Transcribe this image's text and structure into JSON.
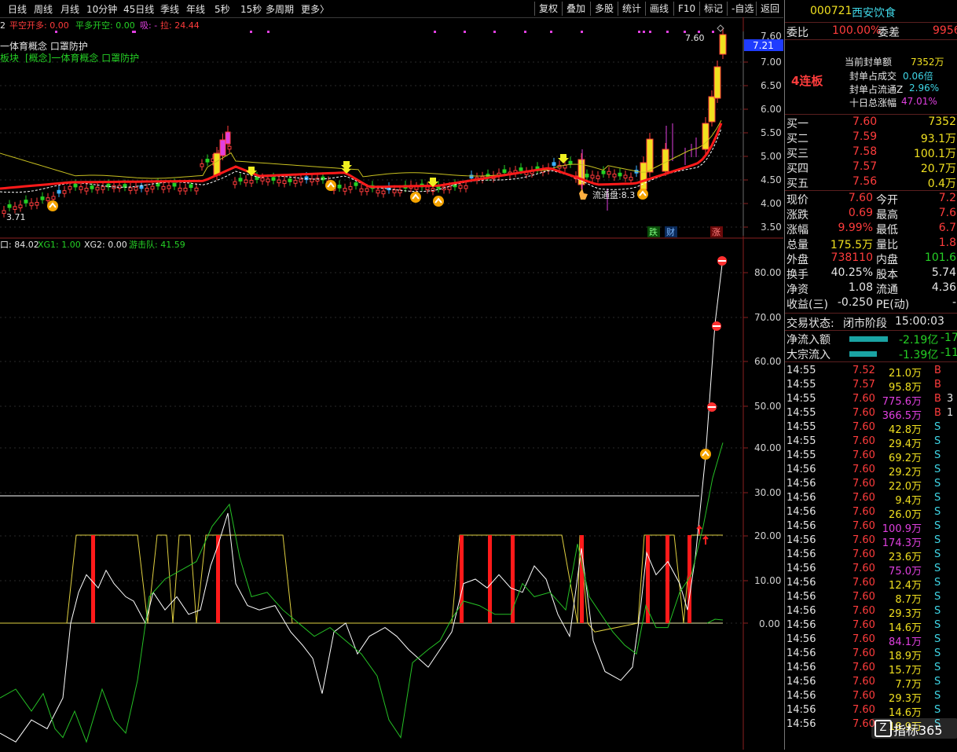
{
  "toolbar": {
    "periods": [
      "日线",
      "周线",
      "月线",
      "10分钟",
      "45日线",
      "季线",
      "年线",
      "5秒",
      "15秒",
      "多周期",
      "更多〉"
    ],
    "actions": [
      "复权",
      "叠加",
      "多股",
      "统计",
      "画线",
      "F10",
      "标记",
      "-自选",
      "返回"
    ]
  },
  "upper": {
    "legend1": {
      "a": "2",
      "b": "平空开多: 0.00",
      "c": "平多开空: 0.00",
      "d": "吸: -",
      "e": "拉: 24.44"
    },
    "concept_line1": "一体育概念 口罩防护",
    "concept_line2_a": "板块",
    "concept_line2_b": "[概念]一体育概念 口罩防护",
    "y_ticks": [
      "7.00",
      "6.50",
      "6.00",
      "5.50",
      "5.00",
      "4.50",
      "4.00",
      "3.50"
    ],
    "y_top": "7.60",
    "price_tag": "7.21",
    "high_label": "7.60",
    "low_label": "3.71",
    "float_label": "流通盘:8.3",
    "tags": {
      "die": "跌",
      "cai": "财",
      "zhang": "涨"
    }
  },
  "lower": {
    "legend": {
      "a": "口: 84.02",
      "b": "XG1: 1.00",
      "c": "XG2: 0.00",
      "d": "游击队: 41.59"
    },
    "y_ticks": [
      "80.00",
      "70.00",
      "60.00",
      "50.00",
      "40.00",
      "30.00",
      "20.00",
      "10.00",
      "0.00"
    ]
  },
  "stock": {
    "code": "000721",
    "name": "西安饮食"
  },
  "weibi": {
    "label": "委比",
    "value": "100.00%",
    "label2": "委差",
    "value2": "9956"
  },
  "seal": {
    "badge": "4连板",
    "rows": [
      {
        "label": "当前封单额",
        "value": "7352万"
      },
      {
        "label": "封单占成交",
        "value": "0.06倍"
      },
      {
        "label": "封单占流通Z",
        "value": "2.96%"
      },
      {
        "label": "十日总涨幅",
        "value": "47.01%"
      }
    ]
  },
  "buys": [
    {
      "label": "买一",
      "price": "7.60",
      "vol": "7352"
    },
    {
      "label": "买二",
      "price": "7.59",
      "vol": "93.1万"
    },
    {
      "label": "买三",
      "price": "7.58",
      "vol": "100.1万"
    },
    {
      "label": "买四",
      "price": "7.57",
      "vol": "20.7万"
    },
    {
      "label": "买五",
      "price": "7.56",
      "vol": "0.4万"
    }
  ],
  "quote": [
    {
      "l1": "现价",
      "v1": "7.60",
      "l2": "今开",
      "v2": "7.2"
    },
    {
      "l1": "涨跌",
      "v1": "0.69",
      "l2": "最高",
      "v2": "7.6"
    },
    {
      "l1": "涨幅",
      "v1": "9.99%",
      "l2": "最低",
      "v2": "6.7"
    },
    {
      "l1": "总量",
      "v1": "175.5万",
      "l2": "量比",
      "v2": "1.8"
    },
    {
      "l1": "外盘",
      "v1": "738110",
      "l2": "内盘",
      "v2": "101.6"
    },
    {
      "l1": "换手",
      "v1": "40.25%",
      "l2": "股本",
      "v2": "5.74"
    },
    {
      "l1": "净资",
      "v1": "1.08",
      "l2": "流通",
      "v2": "4.36"
    },
    {
      "l1": "收益(三)",
      "v1": "-0.250",
      "l2": "PE(动)",
      "v2": "-"
    }
  ],
  "status": {
    "label": "交易状态:",
    "value": "闭市阶段",
    "time": "15:00:03"
  },
  "flows": [
    {
      "label": "净流入额",
      "value": "-2.19亿",
      "extra": "-17",
      "bar": 0.85
    },
    {
      "label": "大宗流入",
      "value": "-1.39亿",
      "extra": "-11",
      "bar": 0.6
    }
  ],
  "ticks": [
    {
      "t": "14:55",
      "p": "7.52",
      "v": "21.0万",
      "s": "B",
      "n": ""
    },
    {
      "t": "14:55",
      "p": "7.57",
      "v": "95.8万",
      "s": "B",
      "n": ""
    },
    {
      "t": "14:55",
      "p": "7.60",
      "v": "775.6万",
      "s": "B",
      "n": "3"
    },
    {
      "t": "14:55",
      "p": "7.60",
      "v": "366.5万",
      "s": "B",
      "n": "1"
    },
    {
      "t": "14:55",
      "p": "7.60",
      "v": "42.8万",
      "s": "S",
      "n": ""
    },
    {
      "t": "14:55",
      "p": "7.60",
      "v": "29.4万",
      "s": "S",
      "n": ""
    },
    {
      "t": "14:55",
      "p": "7.60",
      "v": "69.2万",
      "s": "S",
      "n": ""
    },
    {
      "t": "14:56",
      "p": "7.60",
      "v": "29.2万",
      "s": "S",
      "n": ""
    },
    {
      "t": "14:56",
      "p": "7.60",
      "v": "22.0万",
      "s": "S",
      "n": ""
    },
    {
      "t": "14:56",
      "p": "7.60",
      "v": "9.4万",
      "s": "S",
      "n": ""
    },
    {
      "t": "14:56",
      "p": "7.60",
      "v": "26.0万",
      "s": "S",
      "n": ""
    },
    {
      "t": "14:56",
      "p": "7.60",
      "v": "100.9万",
      "s": "S",
      "n": ""
    },
    {
      "t": "14:56",
      "p": "7.60",
      "v": "174.3万",
      "s": "S",
      "n": ""
    },
    {
      "t": "14:56",
      "p": "7.60",
      "v": "23.6万",
      "s": "S",
      "n": ""
    },
    {
      "t": "14:56",
      "p": "7.60",
      "v": "75.0万",
      "s": "S",
      "n": ""
    },
    {
      "t": "14:56",
      "p": "7.60",
      "v": "12.4万",
      "s": "S",
      "n": ""
    },
    {
      "t": "14:56",
      "p": "7.60",
      "v": "8.7万",
      "s": "S",
      "n": ""
    },
    {
      "t": "14:56",
      "p": "7.60",
      "v": "29.3万",
      "s": "S",
      "n": ""
    },
    {
      "t": "14:56",
      "p": "7.60",
      "v": "14.6万",
      "s": "S",
      "n": ""
    },
    {
      "t": "14:56",
      "p": "7.60",
      "v": "84.1万",
      "s": "S",
      "n": ""
    },
    {
      "t": "14:56",
      "p": "7.60",
      "v": "18.9万",
      "s": "S",
      "n": ""
    },
    {
      "t": "14:56",
      "p": "7.60",
      "v": "15.7万",
      "s": "S",
      "n": ""
    },
    {
      "t": "14:56",
      "p": "7.60",
      "v": "7.7万",
      "s": "S",
      "n": ""
    },
    {
      "t": "14:56",
      "p": "7.60",
      "v": "29.3万",
      "s": "S",
      "n": ""
    },
    {
      "t": "14:56",
      "p": "7.60",
      "v": "14.6万",
      "s": "S",
      "n": ""
    },
    {
      "t": "14:56",
      "p": "7.60",
      "v": "18.9万",
      "s": "S",
      "n": ""
    }
  ],
  "watermark": "指标365",
  "colors": {
    "up": "#ff3c3c",
    "down": "#25d025",
    "yellow": "#f0e020",
    "blue": "#3060ff",
    "magenta": "#e040e0",
    "cyan": "#3fd6e6"
  }
}
